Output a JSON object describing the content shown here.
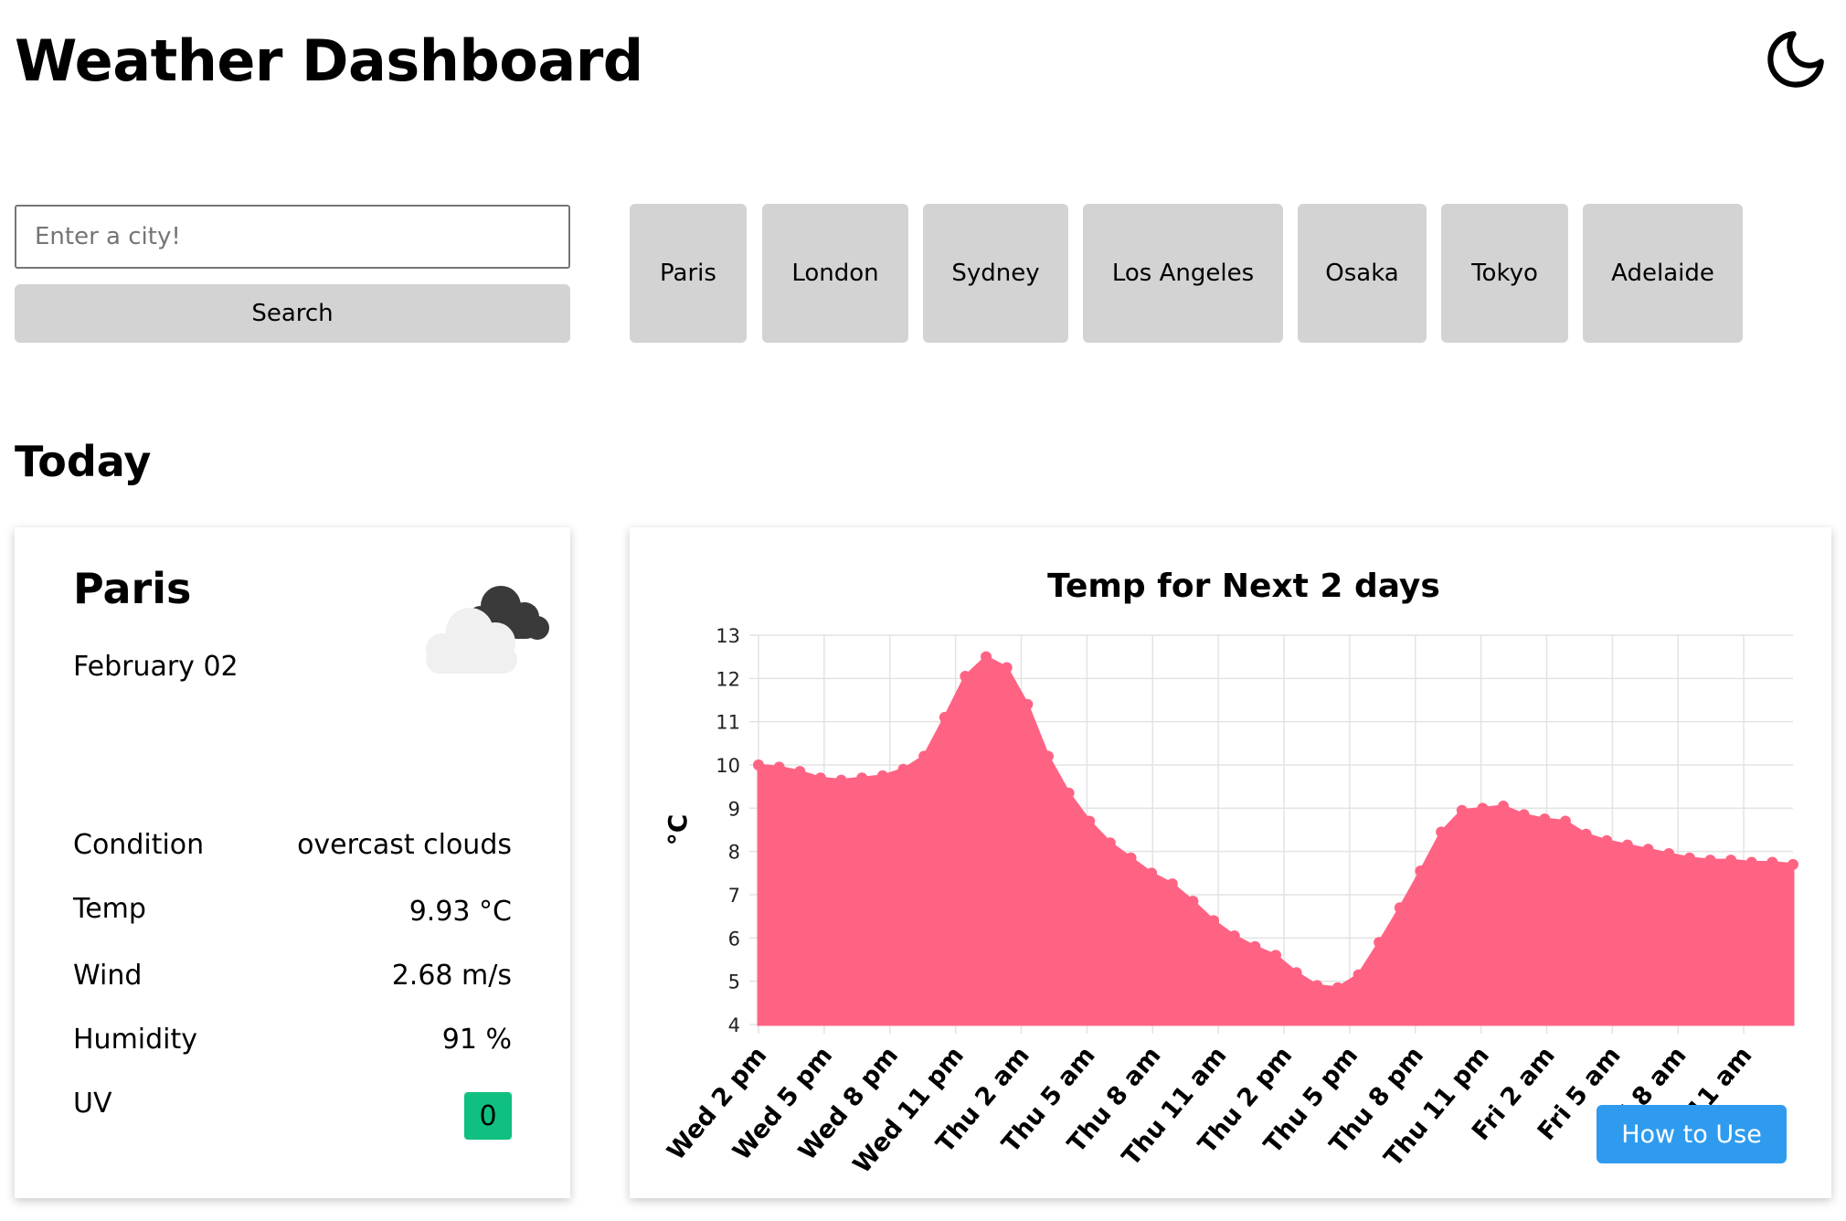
{
  "header": {
    "title": "Weather Dashboard",
    "theme_icon": "moon-icon"
  },
  "search": {
    "placeholder": "Enter a city!",
    "button_label": "Search"
  },
  "cities": [
    "Paris",
    "London",
    "Sydney",
    "Los Angeles",
    "Osaka",
    "Tokyo",
    "Adelaide"
  ],
  "today": {
    "section_title": "Today",
    "city": "Paris",
    "date": "February 02",
    "icon": "overcast-clouds-icon",
    "rows": [
      {
        "label": "Condition",
        "value": "overcast clouds"
      },
      {
        "label": "Temp",
        "value": "9.93 °C"
      },
      {
        "label": "Wind",
        "value": "2.68 m/s"
      },
      {
        "label": "Humidity",
        "value": "91 %"
      },
      {
        "label": "UV",
        "value": "0"
      }
    ],
    "uv_color": "#0fc081"
  },
  "how_to_use_label": "How to Use",
  "colors": {
    "area": "#ff6384",
    "button": "#d3d3d3",
    "accent": "#2f9bef"
  },
  "chart_data": {
    "type": "area",
    "title": "Temp for Next 2 days",
    "ylabel": "°C",
    "xlabel": "",
    "ylim": [
      4,
      13
    ],
    "y_ticks": [
      4,
      5,
      6,
      7,
      8,
      9,
      10,
      11,
      12,
      13
    ],
    "x_tick_labels": [
      "Wed 2 pm",
      "Wed 5 pm",
      "Wed 8 pm",
      "Wed 11 pm",
      "Thu 2 am",
      "Thu 5 am",
      "Thu 8 am",
      "Thu 11 am",
      "Thu 2 pm",
      "Thu 5 pm",
      "Thu 8 pm",
      "Thu 11 pm",
      "Fri 2 am",
      "Fri 5 am",
      "Fri 8 am",
      "Fri 11 am"
    ],
    "grid": true,
    "series": [
      {
        "values": [
          10.0,
          9.95,
          9.85,
          9.7,
          9.65,
          9.7,
          9.75,
          9.9,
          10.2,
          11.1,
          12.05,
          12.5,
          12.25,
          11.4,
          10.2,
          9.35,
          8.7,
          8.2,
          7.85,
          7.5,
          7.25,
          6.85,
          6.4,
          6.05,
          5.8,
          5.6,
          5.2,
          4.9,
          4.85,
          5.15,
          5.9,
          6.7,
          7.55,
          8.45,
          8.95,
          9.0,
          9.05,
          8.85,
          8.75,
          8.7,
          8.4,
          8.25,
          8.15,
          8.05,
          7.95,
          7.85,
          7.8,
          7.8,
          7.75,
          7.75,
          7.7
        ]
      }
    ]
  }
}
